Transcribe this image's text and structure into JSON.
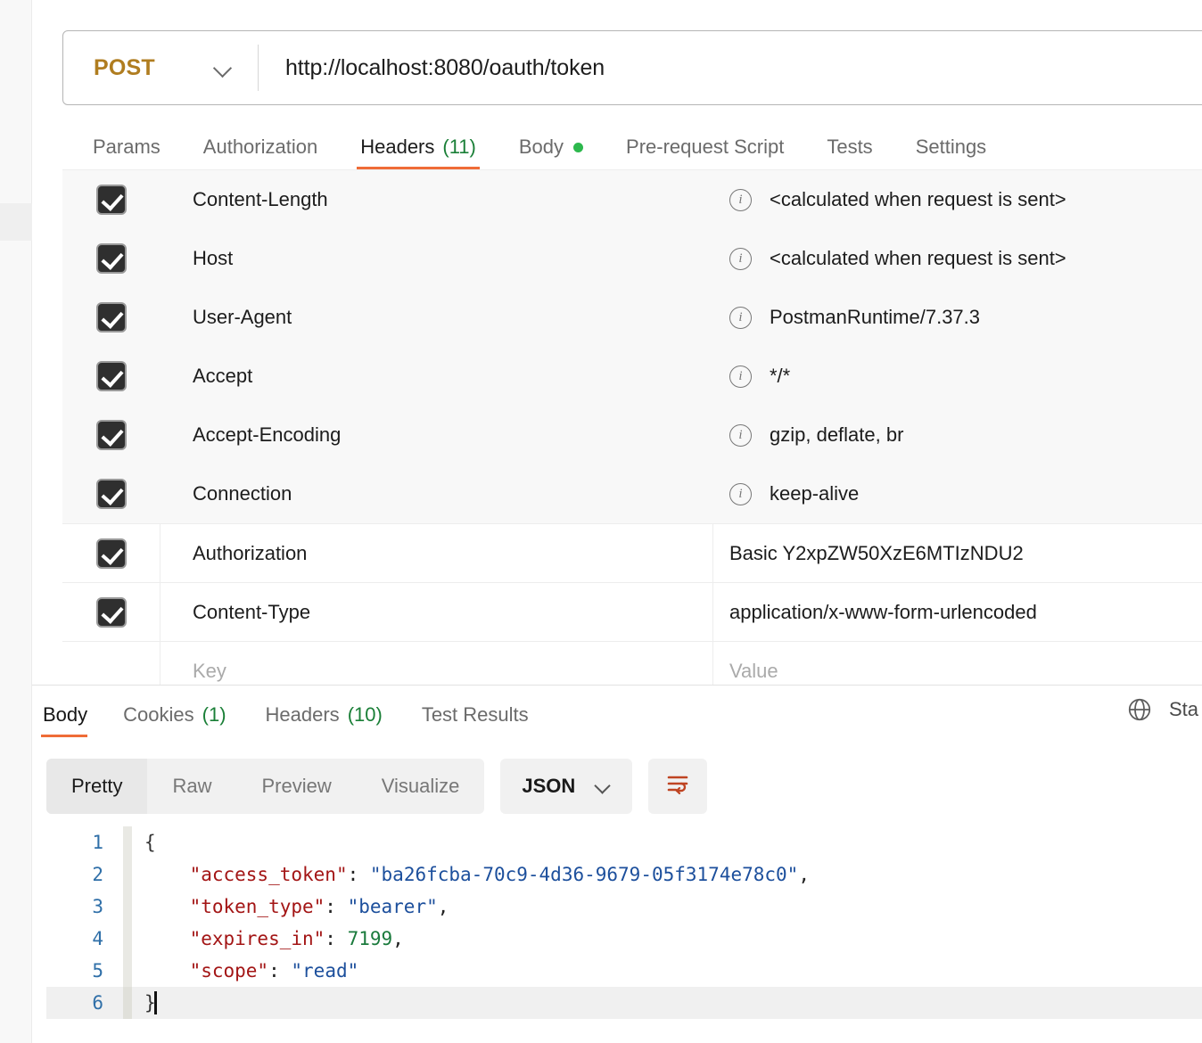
{
  "request": {
    "method": "POST",
    "url": "http://localhost:8080/oauth/token",
    "method_icon": "chevron-down-icon",
    "tabs": [
      {
        "label": "Params",
        "count": "",
        "dot": false,
        "active": false
      },
      {
        "label": "Authorization",
        "count": "",
        "dot": false,
        "active": false
      },
      {
        "label": "Headers",
        "count": "(11)",
        "dot": false,
        "active": true
      },
      {
        "label": "Body",
        "count": "",
        "dot": true,
        "active": false
      },
      {
        "label": "Pre-request Script",
        "count": "",
        "dot": false,
        "active": false
      },
      {
        "label": "Tests",
        "count": "",
        "dot": false,
        "active": false
      },
      {
        "label": "Settings",
        "count": "",
        "dot": false,
        "active": false
      }
    ],
    "headers": [
      {
        "checked": true,
        "key": "Content-Length",
        "value": "<calculated when request is sent>",
        "info": true,
        "auto": true
      },
      {
        "checked": true,
        "key": "Host",
        "value": "<calculated when request is sent>",
        "info": true,
        "auto": true
      },
      {
        "checked": true,
        "key": "User-Agent",
        "value": "PostmanRuntime/7.37.3",
        "info": true,
        "auto": true
      },
      {
        "checked": true,
        "key": "Accept",
        "value": "*/*",
        "info": true,
        "auto": true
      },
      {
        "checked": true,
        "key": "Accept-Encoding",
        "value": "gzip, deflate, br",
        "info": true,
        "auto": true
      },
      {
        "checked": true,
        "key": "Connection",
        "value": "keep-alive",
        "info": true,
        "auto": true
      },
      {
        "checked": true,
        "key": "Authorization",
        "value": "Basic Y2xpZW50XzE6MTIzNDU2",
        "info": false,
        "auto": false
      },
      {
        "checked": true,
        "key": "Content-Type",
        "value": "application/x-www-form-urlencoded",
        "info": false,
        "auto": false
      }
    ],
    "new_row": {
      "key_placeholder": "Key",
      "value_placeholder": "Value"
    }
  },
  "response": {
    "tabs": [
      {
        "label": "Body",
        "count": "",
        "active": true
      },
      {
        "label": "Cookies",
        "count": "(1)",
        "active": false
      },
      {
        "label": "Headers",
        "count": "(10)",
        "active": false
      },
      {
        "label": "Test Results",
        "count": "",
        "active": false
      }
    ],
    "globe_icon": "globe-icon",
    "status_text": "Sta",
    "viewer": {
      "modes": [
        "Pretty",
        "Raw",
        "Preview",
        "Visualize"
      ],
      "active_mode": "Pretty",
      "format": "JSON",
      "format_icon": "chevron-down-icon",
      "wrap_icon": "wrap-text-icon"
    },
    "body_json": {
      "access_token": "ba26fcba-70c9-4d36-9679-05f3174e78c0",
      "token_type": "bearer",
      "expires_in": 7199,
      "scope": "read"
    },
    "code_lines": [
      {
        "n": "1",
        "type": "brace-open",
        "text": "{"
      },
      {
        "n": "2",
        "type": "pair-string",
        "key": "\"access_token\"",
        "value": "\"ba26fcba-70c9-4d36-9679-05f3174e78c0\"",
        "comma": ","
      },
      {
        "n": "3",
        "type": "pair-string",
        "key": "\"token_type\"",
        "value": "\"bearer\"",
        "comma": ","
      },
      {
        "n": "4",
        "type": "pair-number",
        "key": "\"expires_in\"",
        "value": "7199",
        "comma": ","
      },
      {
        "n": "5",
        "type": "pair-string",
        "key": "\"scope\"",
        "value": "\"read\"",
        "comma": ""
      },
      {
        "n": "6",
        "type": "brace-close",
        "text": "}"
      }
    ]
  },
  "colors": {
    "accent": "#ef6c37",
    "method": "#b07d20",
    "count_green": "#1a7f37",
    "body_dot_green": "#2db84d",
    "json_key": "#a31515",
    "json_string": "#1c4f9c",
    "json_number": "#1a7a3c",
    "line_number": "#2f6fa8"
  }
}
